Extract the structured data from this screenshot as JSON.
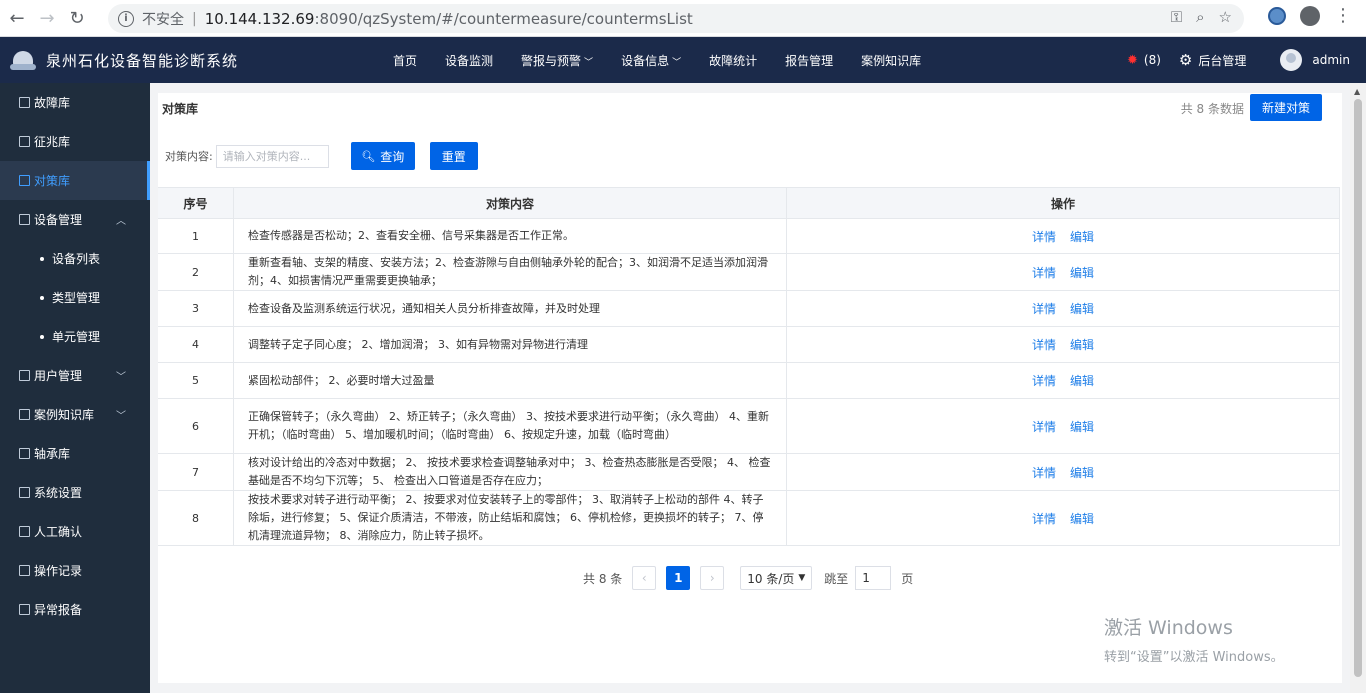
{
  "browser": {
    "security_label": "不安全",
    "url_host": "10.144.132.69",
    "url_rest": ":8090/qzSystem/#/countermeasure/countermsList"
  },
  "header": {
    "title": "泉州石化设备智能诊断系统",
    "nav": [
      {
        "label": "首页",
        "caret": false
      },
      {
        "label": "设备监测",
        "caret": false
      },
      {
        "label": "警报与预警",
        "caret": true
      },
      {
        "label": "设备信息",
        "caret": true
      },
      {
        "label": "故障统计",
        "caret": false
      },
      {
        "label": "报告管理",
        "caret": false
      },
      {
        "label": "案例知识库",
        "caret": false
      }
    ],
    "alarm_count": "(8)",
    "admin_link": "后台管理",
    "user": "admin"
  },
  "sidebar": {
    "items": [
      {
        "label": "故障库",
        "type": "item"
      },
      {
        "label": "征兆库",
        "type": "item"
      },
      {
        "label": "对策库",
        "type": "item",
        "active": true
      },
      {
        "label": "设备管理",
        "type": "group",
        "arrow": "︿"
      },
      {
        "label": "设备列表",
        "type": "sub"
      },
      {
        "label": "类型管理",
        "type": "sub"
      },
      {
        "label": "单元管理",
        "type": "sub"
      },
      {
        "label": "用户管理",
        "type": "group",
        "arrow": "﹀"
      },
      {
        "label": "案例知识库",
        "type": "group",
        "arrow": "﹀"
      },
      {
        "label": "轴承库",
        "type": "item"
      },
      {
        "label": "系统设置",
        "type": "item"
      },
      {
        "label": "人工确认",
        "type": "item"
      },
      {
        "label": "操作记录",
        "type": "item"
      },
      {
        "label": "异常报备",
        "type": "item"
      }
    ]
  },
  "page": {
    "breadcrumb": "对策库",
    "total_text": "共 8 条数据",
    "new_button": "新建对策",
    "filter_label": "对策内容:",
    "filter_placeholder": "请输入对策内容...",
    "query_button": "查询",
    "reset_button": "重置"
  },
  "table": {
    "headers": [
      "序号",
      "对策内容",
      "操作"
    ],
    "detail_label": "详情",
    "edit_label": "编辑",
    "rows": [
      {
        "no": "1",
        "content": "检查传感器是否松动；2、查看安全栅、信号采集器是否工作正常。"
      },
      {
        "no": "2",
        "content": "重新查看轴、支架的精度、安装方法；2、检查游隙与自由侧轴承外轮的配合；3、如润滑不足适当添加润滑剂；4、如损害情况严重需要更换轴承；"
      },
      {
        "no": "3",
        "content": "检查设备及监测系统运行状况，通知相关人员分析排查故障，并及时处理"
      },
      {
        "no": "4",
        "content": "调整转子定子同心度； 2、增加润滑； 3、如有异物需对异物进行清理"
      },
      {
        "no": "5",
        "content": "紧固松动部件； 2、必要时增大过盈量"
      },
      {
        "no": "6",
        "content": "正确保管转子；（永久弯曲） 2、矫正转子；（永久弯曲） 3、按技术要求进行动平衡；（永久弯曲） 4、重新开机；（临时弯曲） 5、增加暖机时间；（临时弯曲） 6、按规定升速，加载（临时弯曲）"
      },
      {
        "no": "7",
        "content": "核对设计给出的冷态对中数据； 2、 按技术要求检查调整轴承对中； 3、检查热态膨胀是否受限； 4、 检查基础是否不均匀下沉等； 5、 检查出入口管道是否存在应力；"
      },
      {
        "no": "8",
        "content": "按技术要求对转子进行动平衡； 2、按要求对位安装转子上的零部件； 3、取消转子上松动的部件 4、转子除垢，进行修复； 5、保证介质清洁，不带液，防止结垢和腐蚀； 6、停机检修，更换损坏的转子； 7、停机清理流道异物； 8、消除应力，防止转子损坏。"
      }
    ]
  },
  "pagination": {
    "total": "共 8 条",
    "current": "1",
    "page_size": "10 条/页",
    "jump_label": "跳至",
    "jump_value": "1",
    "page_unit": "页"
  },
  "watermark": {
    "line1": "激活 Windows",
    "line2": "转到“设置”以激活 Windows。"
  }
}
